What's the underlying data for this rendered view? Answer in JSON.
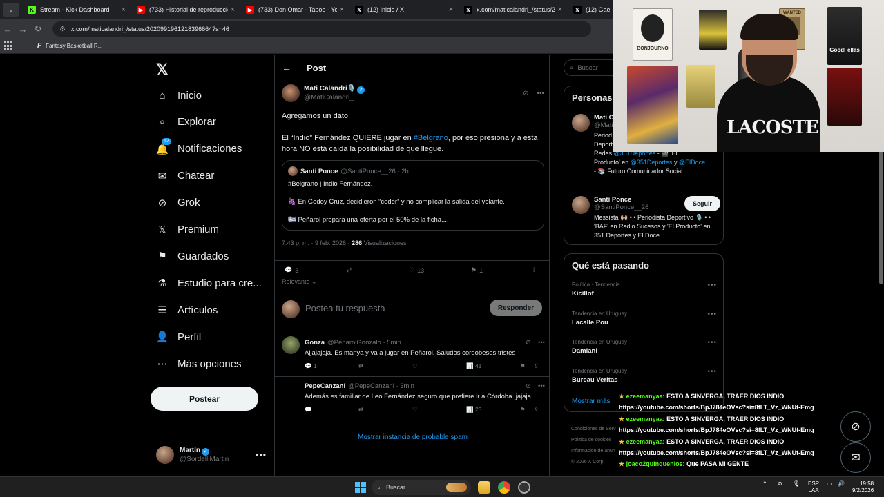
{
  "browser": {
    "tabs": [
      {
        "title": "Stream - Kick Dashboard",
        "favicon": "kick-icon",
        "color": "#53fc18"
      },
      {
        "title": "(733) Historial de reproducción",
        "favicon": "youtube-icon",
        "color": "#ff0000"
      },
      {
        "title": "(733) Don Omar - Taboo - YouT",
        "favicon": "youtube-icon",
        "color": "#ff0000"
      },
      {
        "title": "(12) Inicio / X",
        "favicon": "x-icon",
        "color": "#000000"
      },
      {
        "title": "x.com/maticalandri_/status/202",
        "favicon": "x-icon",
        "color": "#000000"
      },
      {
        "title": "(12) Gael Vázq",
        "favicon": "x-icon",
        "color": "#000000"
      }
    ],
    "url": "x.com/maticalandri_/status/2020991961218396664?s=46",
    "bookmark": "Fantasy Basketball R..."
  },
  "nav": {
    "items": [
      {
        "label": "Inicio",
        "icon": "home-icon"
      },
      {
        "label": "Explorar",
        "icon": "search-icon"
      },
      {
        "label": "Notificaciones",
        "icon": "bell-icon",
        "badge": "12"
      },
      {
        "label": "Chatear",
        "icon": "mail-icon"
      },
      {
        "label": "Grok",
        "icon": "grok-icon"
      },
      {
        "label": "Premium",
        "icon": "x-icon"
      },
      {
        "label": "Guardados",
        "icon": "bookmark-icon"
      },
      {
        "label": "Estudio para cre...",
        "icon": "flask-icon"
      },
      {
        "label": "Artículos",
        "icon": "article-icon"
      },
      {
        "label": "Perfil",
        "icon": "person-icon"
      },
      {
        "label": "Más opciones",
        "icon": "more-icon"
      }
    ],
    "post_button": "Postear",
    "me": {
      "name": "Martín",
      "handle": "@SordelliMartin"
    }
  },
  "post": {
    "header": "Post",
    "author": {
      "name": "Mati Calandri",
      "emoji": "🎙️",
      "handle": "@MatiCalandri_"
    },
    "line1": "Agregamos un dato:",
    "line2_pre": "El “Indio” Fernández QUIERE jugar en ",
    "line2_link": "#Belgrano",
    "line2_post": ", por eso presiona y a esta hora NO está caída la posibilidad de que llegue.",
    "quote": {
      "name": "Santi Ponce",
      "handle": "@SantiPonce__26 · 2h",
      "l1": "#Belgrano | Indio Fernández.",
      "l2": "🍇 En Godoy Cruz, decidieron “ceder” y no complicar la salida del volante.",
      "l3": "🇺🇾 Peñarol prepara una oferta por el 50% de la ficha...."
    },
    "meta_time": "7:43 p. m. · 9 feb. 2026 · ",
    "meta_views": "286",
    "meta_views_label": " Visualizaciones",
    "actions": {
      "replies": "3",
      "likes": "13",
      "bookmarks": "1"
    },
    "sort": "Relevante",
    "reply_placeholder": "Postea tu respuesta",
    "reply_button": "Responder"
  },
  "replies": [
    {
      "name": "Gonza",
      "handle": "@PenarolGonzalo · 5min",
      "text": "Ajjajajaja. Es manya y va a jugar en Peñarol. Saludos cordobeses tristes",
      "replies": "1",
      "likes": "",
      "views": "41"
    },
    {
      "name": "PepeCanzani",
      "handle": "@PepeCanzani · 3min",
      "text": "Además es familiar de Leo Fernández seguro que prefiere ir a Córdoba..jajaja",
      "replies": "",
      "likes": "",
      "views": "23"
    }
  ],
  "spam_link": "Mostrar instancia de probable spam",
  "right": {
    "search_placeholder": "Buscar",
    "people_title": "Personas",
    "person1": {
      "name": "Mati C",
      "handle": "@Mati",
      "bio1": "Period",
      "bio2": "Deport",
      "bio3_pre": "Redes ",
      "bio3_link": "@351Deportes",
      "bio3_post": " - 🎬 'El",
      "bio4_pre": "Producto' en ",
      "bio4_link1": "@351Deportes",
      "bio4_mid": " y ",
      "bio4_link2": "@ElDoce",
      "bio5": "- 📚 Futuro Comunicador Social."
    },
    "person2": {
      "name": "Santi Ponce",
      "handle": "@SantiPonce__26",
      "follow": "Seguir",
      "bio": "Messista 🙌🏼 • • Periodista Deportivo 🎙️ • • 'BAF' en Radio Sucesos y 'El Producto' en 351 Deportes y El Doce."
    },
    "trends_title": "Qué está pasando",
    "trends": [
      {
        "category": "Política · Tendencia",
        "title": "Kicillof"
      },
      {
        "category": "Tendencia en Uruguay",
        "title": "Lacalle Pou"
      },
      {
        "category": "Tendencia en Uruguay",
        "title": "Damiani"
      },
      {
        "category": "Tendencia en Uruguay",
        "title": "Bureau Veritas"
      }
    ],
    "show_more": "Mostrar más",
    "footer": [
      "Condiciones de Serv",
      "Política de cookies",
      "Información de anun",
      "© 2026 X Corp."
    ]
  },
  "chat": [
    {
      "user": "ezeemanyaa",
      "msg": ": ESTO A SINVERGA, TRAER DIOS INDIO",
      "link": "https://youtube.com/shorts/BpJ784eOVsc?si=8fLT_Vz_WNUt-Emg"
    },
    {
      "user": "ezeemanyaa",
      "msg": ": ESTO A SINVERGA, TRAER DIOS INDIO",
      "link": "https://youtube.com/shorts/BpJ784eOVsc?si=8fLT_Vz_WNUt-Emg"
    },
    {
      "user": "ezeemanyaa",
      "msg": ": ESTO A SINVERGA, TRAER DIOS INDIO",
      "link": "https://youtube.com/shorts/BpJ784eOVsc?si=8fLT_Vz_WNUt-Emg"
    },
    {
      "user": "joaco2quinquenios",
      "msg": ": Que PASA MI GENTE",
      "link": ""
    }
  ],
  "webcam": {
    "shirt": "LACOSTE",
    "poster_wanted": "WANTED",
    "poster_goodfellas": "GoodFellas",
    "poster_bonjourno": "BONJOURNO"
  },
  "taskbar": {
    "search": "Buscar",
    "lang1": "ESP",
    "lang2": "LAA",
    "time": "19:58",
    "date": "9/2/2026"
  }
}
